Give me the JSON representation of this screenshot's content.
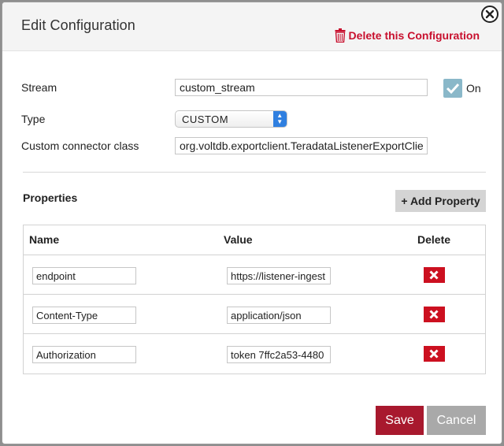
{
  "dialog": {
    "title": "Edit Configuration",
    "delete_config_label": "Delete this Configuration",
    "colors": {
      "accent_red": "#c8102e",
      "save_bg": "#a8192e",
      "toggle_bg": "#8ab8c9",
      "select_arrow": "#2f7fe0"
    }
  },
  "form": {
    "stream_label": "Stream",
    "stream_value": "custom_stream",
    "toggle_label": "On",
    "toggle_checked": true,
    "type_label": "Type",
    "type_value": "CUSTOM",
    "connector_label": "Custom connector class",
    "connector_value": "org.voltdb.exportclient.TeradataListenerExportClient"
  },
  "properties": {
    "section_title": "Properties",
    "add_button_label": "Add Property",
    "add_icon": "plus-icon",
    "headers": {
      "name": "Name",
      "value": "Value",
      "delete": "Delete"
    },
    "rows": [
      {
        "name": "endpoint",
        "value": "https://listener-ingest"
      },
      {
        "name": "Content-Type",
        "value": "application/json"
      },
      {
        "name": "Authorization",
        "value": "token 7ffc2a53-4480"
      }
    ]
  },
  "footer": {
    "save_label": "Save",
    "cancel_label": "Cancel"
  }
}
